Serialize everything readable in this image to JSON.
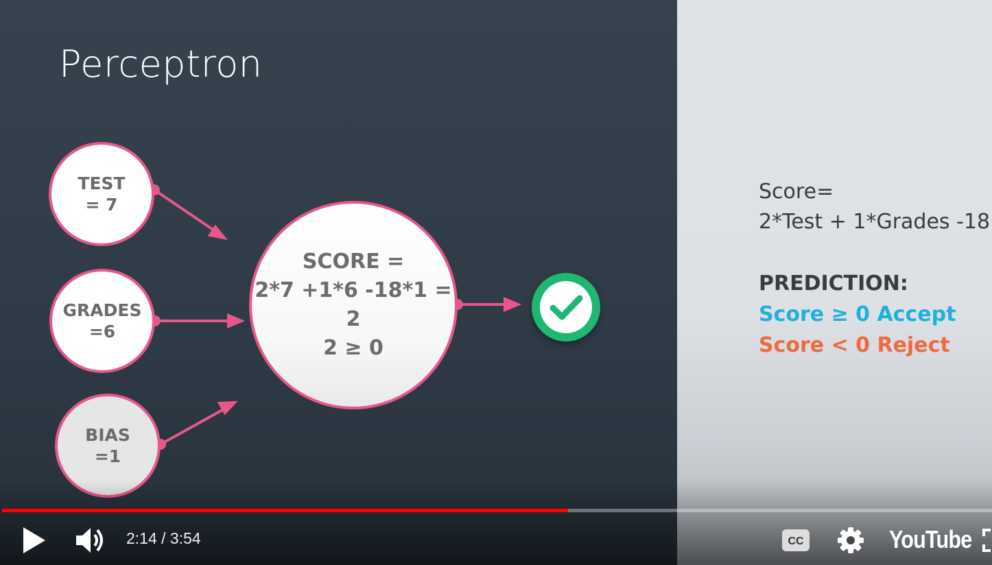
{
  "slide": {
    "title": "Perceptron",
    "nodes": {
      "test": "TEST\n= 7",
      "grades": "GRADES\n=6",
      "bias": "BIAS\n=1"
    },
    "score_node": {
      "line1": "SCORE =",
      "line2": "2*7 +1*6 -18*1 = 2",
      "line3": "2 ≥ 0"
    },
    "output_icon": "check-circle-icon",
    "colors": {
      "edge": "#e7578a",
      "check": "#1fb872",
      "accept": "#1fb1de",
      "reject": "#ee6a3f"
    }
  },
  "side_panel": {
    "formula_label": "Score=",
    "formula": "2*Test + 1*Grades -18",
    "prediction_heading": "PREDICTION:",
    "accept_rule": "Score ≥ 0 Accept",
    "reject_rule": "Score < 0 Reject"
  },
  "player": {
    "time_display": "2:14 / 3:54",
    "progress_fraction": 0.572,
    "logo": "YouTube",
    "icons": [
      "play-icon",
      "volume-icon",
      "captions-icon",
      "settings-icon",
      "fullscreen-icon"
    ]
  }
}
